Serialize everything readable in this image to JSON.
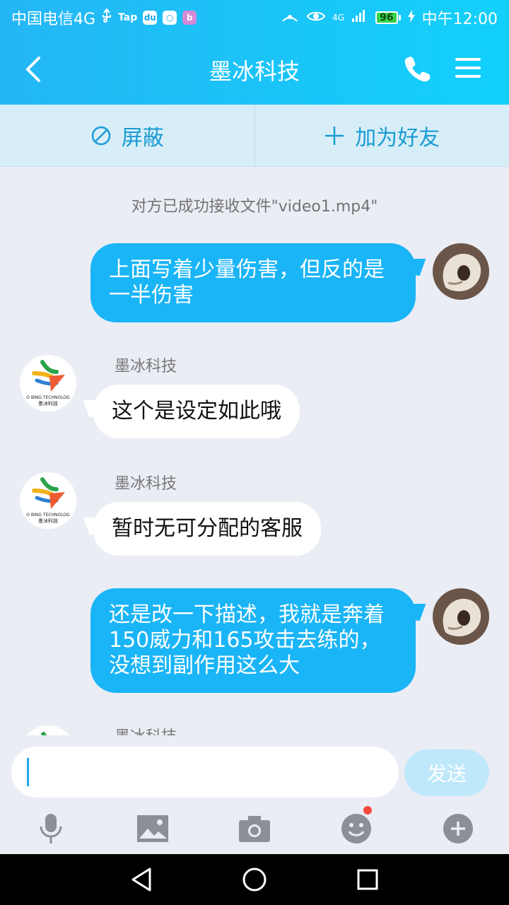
{
  "status_bar": {
    "carrier": "中国电信4G",
    "usb_icon": "usb-icon",
    "app_label_1": "Tap",
    "network": "4G",
    "battery": "96",
    "time": "中午12:00"
  },
  "header": {
    "title": "墨冰科技",
    "back_icon": "back-arrow-icon",
    "call_icon": "phone-icon",
    "menu_icon": "menu-icon"
  },
  "actions": {
    "block_label": "屏蔽",
    "add_friend_label": "加为好友"
  },
  "chat": {
    "system_note": "对方已成功接收文件\"video1.mp4\"",
    "messages": [
      {
        "from": "me",
        "text": "上面写着少量伤害，但反的是一半伤害"
      },
      {
        "from": "them",
        "sender": "墨冰科技",
        "text": "这个是设定如此哦"
      },
      {
        "from": "them",
        "sender": "墨冰科技",
        "text": "暂时无可分配的客服"
      },
      {
        "from": "me",
        "text": "还是改一下描述，我就是奔着150威力和165攻击去练的，没想到副作用这么大"
      },
      {
        "from": "them",
        "sender": "墨冰科技",
        "text": ""
      }
    ],
    "brand_avatar_text_1": "O BING TECHNOLOG",
    "brand_avatar_text_2": "墨冰科技"
  },
  "input": {
    "send_label": "发送"
  },
  "toolbar": {
    "items": [
      "microphone-icon",
      "image-icon",
      "camera-icon",
      "emoji-icon",
      "plus-icon"
    ]
  },
  "colors": {
    "accent": "#1ab5f7",
    "action_bg": "#d7eef8",
    "chat_bg": "#ebedf5"
  }
}
